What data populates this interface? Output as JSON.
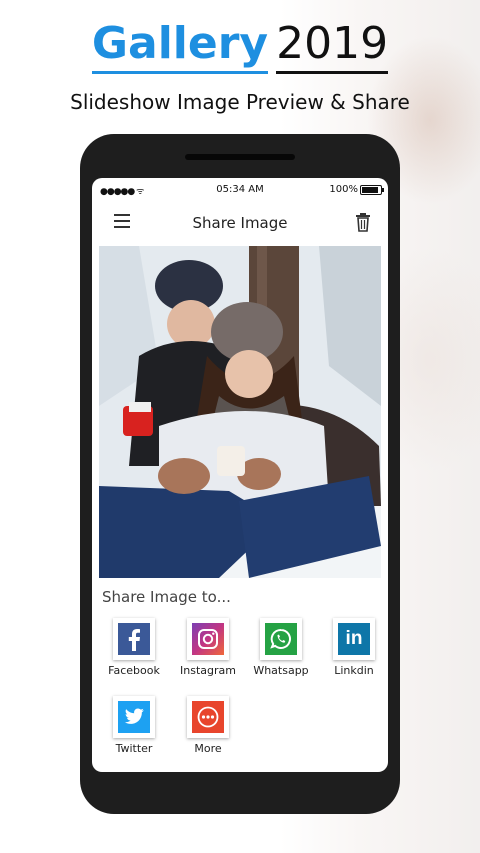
{
  "header": {
    "title_word": "Gallery",
    "title_year": "2019",
    "subtitle": "Slideshow Image Preview & Share"
  },
  "status_bar": {
    "time": "05:34 AM",
    "battery": "100%",
    "signal": "●●●●● ᯤ"
  },
  "app_bar": {
    "title": "Share Image",
    "menu_icon": "hamburger-menu-icon",
    "delete_icon": "trash-icon"
  },
  "share": {
    "label": "Share Image to...",
    "targets": [
      {
        "label": "Facebook",
        "icon": "facebook-icon",
        "color": "#3b5998"
      },
      {
        "label": "Instagram",
        "icon": "instagram-icon",
        "color": "#c13584"
      },
      {
        "label": "Whatsapp",
        "icon": "whatsapp-icon",
        "color": "#25a244"
      },
      {
        "label": "Linkdin",
        "icon": "linkedin-icon",
        "color": "#0e76a8"
      },
      {
        "label": "Twitter",
        "icon": "twitter-icon",
        "color": "#1da1f2"
      },
      {
        "label": "More",
        "icon": "more-icon",
        "color": "#e8452c"
      }
    ]
  },
  "colors": {
    "accent": "#1e8fe0",
    "phone_body": "#1e1e1e"
  }
}
